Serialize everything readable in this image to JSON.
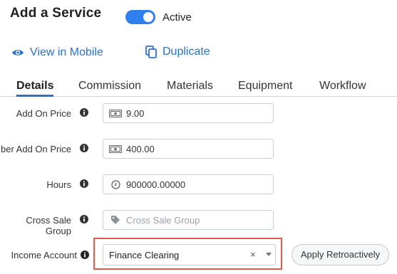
{
  "header": {
    "title": "Add a Service",
    "toggle_label": "Active",
    "toggle_on": true,
    "view_mobile_label": "View in Mobile",
    "duplicate_label": "Duplicate"
  },
  "tabs": [
    {
      "label": "Details",
      "active": true
    },
    {
      "label": "Commission",
      "active": false
    },
    {
      "label": "Materials",
      "active": false
    },
    {
      "label": "Equipment",
      "active": false
    },
    {
      "label": "Workflow",
      "active": false
    }
  ],
  "form": {
    "add_on_price": {
      "label": "Add On Price",
      "value": "9.00",
      "icon": "money-icon"
    },
    "member_add_on_price": {
      "label": "ber Add On Price",
      "value": "400.00",
      "icon": "money-icon"
    },
    "hours": {
      "label": "Hours",
      "value": "900000.00000",
      "icon": "clock-icon"
    },
    "cross_sale_group": {
      "label": "Cross Sale Group",
      "placeholder": "Cross Sale Group",
      "icon": "tag-icon"
    },
    "income_account": {
      "label": "Income Account",
      "value": "Finance Clearing",
      "clear": "×"
    },
    "apply_button": "Apply Retroactively"
  },
  "colors": {
    "accent": "#2a73c9",
    "toggle": "#2f80ed",
    "highlight": "#e05a4f"
  }
}
